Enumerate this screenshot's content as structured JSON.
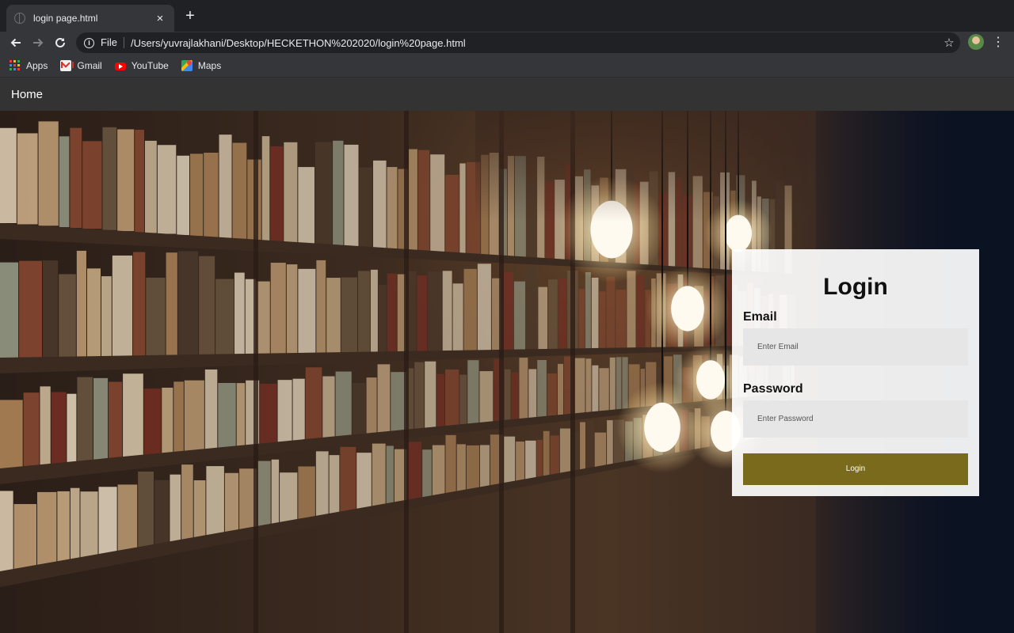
{
  "browser": {
    "tab": {
      "title": "login page.html",
      "close": "×"
    },
    "new_tab": "+",
    "omnibox": {
      "scheme": "File",
      "url": "/Users/yuvrajlakhani/Desktop/HECKETHON%202020/login%20page.html",
      "bookmark_star": "☆"
    },
    "menu": "⋮",
    "bookmarks": [
      {
        "label": "Apps",
        "icon": "apps-grid-icon"
      },
      {
        "label": "Gmail",
        "icon": "gmail-icon"
      },
      {
        "label": "YouTube",
        "icon": "youtube-icon"
      },
      {
        "label": "Maps",
        "icon": "maps-icon"
      }
    ]
  },
  "navbar": {
    "home": "Home"
  },
  "login": {
    "title": "Login",
    "email_label": "Email",
    "email_placeholder": "Enter Email",
    "password_label": "Password",
    "password_placeholder": "Enter Password",
    "button": "Login"
  },
  "colors": {
    "login_button": "#7a6a1c",
    "navbar": "#333333",
    "input_bg": "#e6e6e6"
  }
}
